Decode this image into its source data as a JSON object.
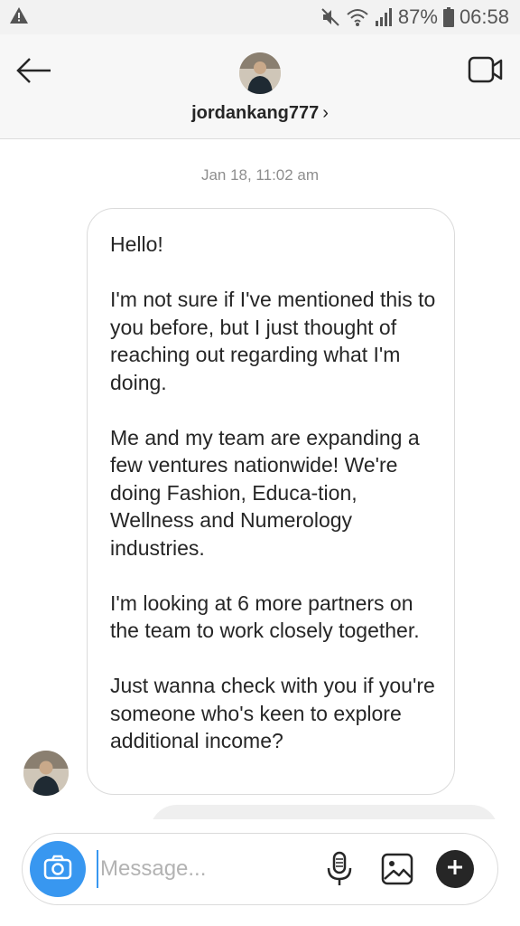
{
  "status_bar": {
    "battery": "87%",
    "time": "06:58",
    "icons": [
      "warning-icon",
      "mute-icon",
      "wifi-icon",
      "signal-icon",
      "battery-icon"
    ]
  },
  "header": {
    "username": "jordankang777",
    "chevron": "›",
    "icons": [
      "back-arrow-icon",
      "video-call-icon"
    ]
  },
  "chat": {
    "timestamp": "Jan 18, 11:02 am",
    "message_paragraphs": [
      "Hello!",
      "I'm not sure if I've mentioned this to you before, but I just thought of reaching out regarding what I'm doing.",
      "Me and my team are expanding a few ventures nationwide! We're doing Fashion, Educa-tion, Wellness and Numerology industries.",
      "I'm looking at 6 more partners on the team to work closely together.",
      "Just wanna check with you if you're someone who's keen to explore additional income?"
    ]
  },
  "composer": {
    "placeholder": "Message...",
    "icons": [
      "camera-icon",
      "microphone-icon",
      "gallery-icon",
      "plus-icon"
    ]
  },
  "colors": {
    "accent": "#3897f0",
    "text": "#262626",
    "muted": "#8e8e8e",
    "border": "#dbdbdb"
  }
}
